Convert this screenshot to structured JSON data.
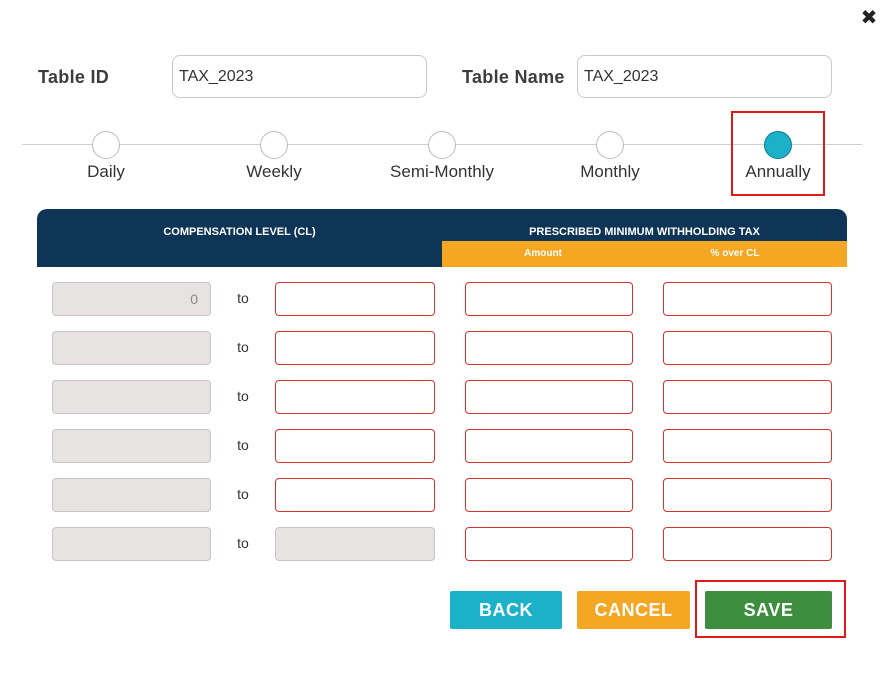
{
  "dialog": {
    "close_glyph": "✖"
  },
  "form": {
    "table_id_label": "Table ID",
    "table_id_value": "TAX_2023",
    "table_name_label": "Table Name",
    "table_name_value": "TAX_2023"
  },
  "frequency": {
    "options": [
      "Daily",
      "Weekly",
      "Semi-Monthly",
      "Monthly",
      "Annually"
    ],
    "selected": "Annually"
  },
  "table": {
    "compensation_header": "COMPENSATION LEVEL (CL)",
    "withholding_header": "PRESCRIBED MINIMUM WITHHOLDING TAX",
    "amount_header": "Amount",
    "percent_header": "% over CL",
    "to_label": "to",
    "rows": [
      {
        "from": "0",
        "to": "",
        "amount": "",
        "percent": ""
      },
      {
        "from": "",
        "to": "",
        "amount": "",
        "percent": ""
      },
      {
        "from": "",
        "to": "",
        "amount": "",
        "percent": ""
      },
      {
        "from": "",
        "to": "",
        "amount": "",
        "percent": ""
      },
      {
        "from": "",
        "to": "",
        "amount": "",
        "percent": ""
      },
      {
        "from": "",
        "to": "",
        "amount": "",
        "percent": ""
      }
    ]
  },
  "actions": {
    "back_label": "BACK",
    "cancel_label": "CANCEL",
    "save_label": "SAVE"
  },
  "colors": {
    "header_navy": "#0e3556",
    "header_orange": "#f5a623",
    "active_step": "#1ab1c9",
    "back_button": "#1ab1c9",
    "cancel_button": "#f5a623",
    "save_button": "#3d8f3f",
    "highlight_red": "#e01a1a"
  }
}
